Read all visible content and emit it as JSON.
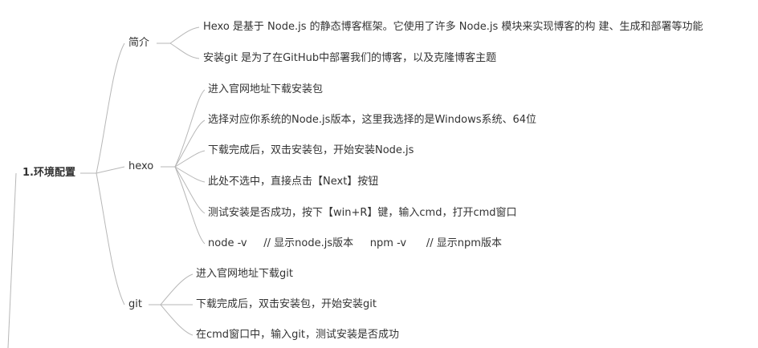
{
  "root": {
    "label": "1.环境配置"
  },
  "branches": [
    {
      "label": "简介",
      "children": [
        "Hexo 是基于 Node.js 的静态博客框架。它使用了许多 Node.js 模块来实现博客的构 建、生成和部署等功能",
        "安装git 是为了在GitHub中部署我们的博客，以及克隆博客主题"
      ]
    },
    {
      "label": "hexo",
      "children": [
        "进入官网地址下载安装包",
        "选择对应你系统的Node.js版本，这里我选择的是Windows系统、64位",
        "下载完成后，双击安装包，开始安装Node.js",
        "此处不选中，直接点击【Next】按钮",
        "测试安装是否成功，按下【win+R】键，输入cmd，打开cmd窗口",
        "node -v     // 显示node.js版本     npm -v      // 显示npm版本"
      ]
    },
    {
      "label": "git",
      "children": [
        "进入官网地址下载git",
        "下载完成后，双击安装包，开始安装git",
        "在cmd窗口中，输入git，测试安装是否成功"
      ]
    }
  ],
  "colors": {
    "line": "#b7b7b7",
    "text": "#333333",
    "background": "#ffffff"
  }
}
